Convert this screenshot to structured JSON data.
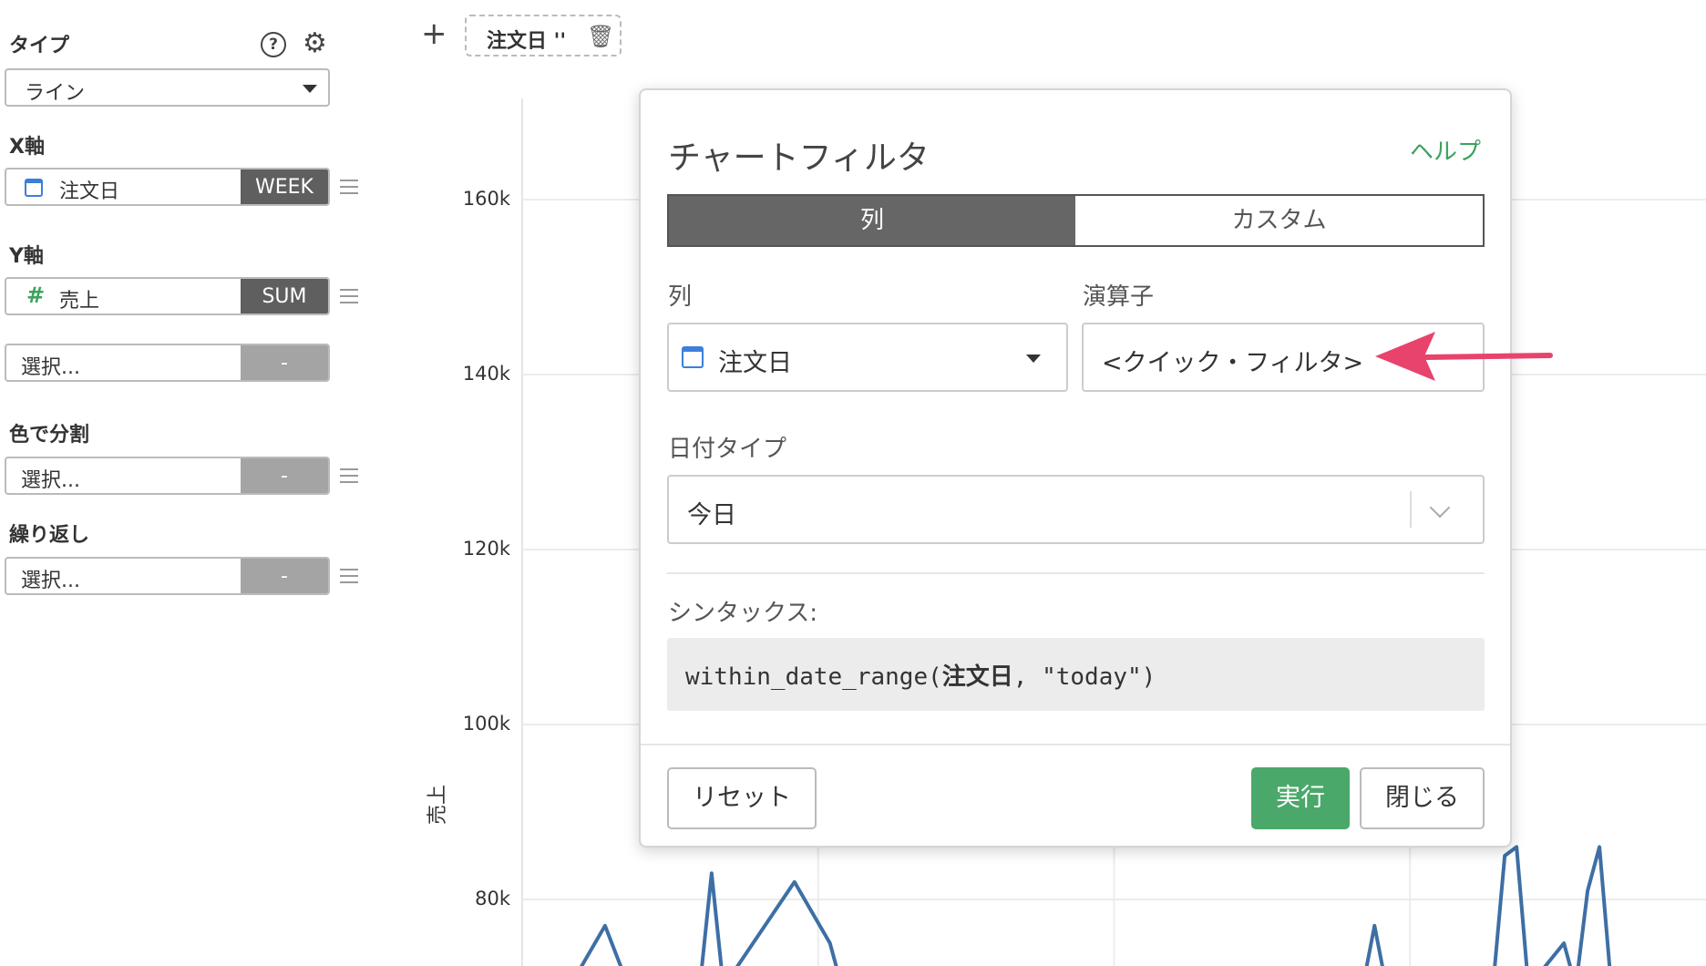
{
  "sidebar": {
    "type_label": "タイプ",
    "type_value": "ライン",
    "x_axis_label": "X軸",
    "x_field": {
      "name": "注文日",
      "agg": "WEEK"
    },
    "y_axis_label": "Y軸",
    "y_field": {
      "name": "売上",
      "agg": "SUM"
    },
    "y_field2": {
      "name": "選択...",
      "agg": "-"
    },
    "color_label": "色で分割",
    "color_field": {
      "name": "選択...",
      "agg": "-"
    },
    "repeat_label": "繰り返し",
    "repeat_field": {
      "name": "選択...",
      "agg": "-"
    }
  },
  "filter_bar": {
    "plus": "+",
    "chip_label": "注文日 ''"
  },
  "chart": {
    "ylabel": "売上",
    "ticks": [
      "160k",
      "140k",
      "120k",
      "100k",
      "80k"
    ],
    "line_color": "#3d6fa5"
  },
  "chart_data": {
    "type": "line",
    "xlabel": "",
    "ylabel": "売上",
    "y_ticks": [
      80000,
      100000,
      120000,
      140000,
      160000
    ],
    "ylim": [
      70000,
      170000
    ],
    "grid": true,
    "series": [
      {
        "values": [
          [
            0.04,
            70000
          ],
          [
            0.07,
            77000
          ],
          [
            0.09,
            70000
          ],
          [
            0.15,
            70000
          ],
          [
            0.16,
            83000
          ],
          [
            0.17,
            70000
          ],
          [
            0.23,
            82000
          ],
          [
            0.26,
            75000
          ],
          [
            0.27,
            70000
          ],
          [
            0.71,
            70000
          ],
          [
            0.72,
            77000
          ],
          [
            0.73,
            70000
          ],
          [
            0.82,
            70000
          ],
          [
            0.83,
            85000
          ],
          [
            0.84,
            86000
          ],
          [
            0.85,
            70000
          ],
          [
            0.88,
            75000
          ],
          [
            0.89,
            70000
          ],
          [
            0.9,
            81000
          ],
          [
            0.91,
            86000
          ],
          [
            0.92,
            70000
          ]
        ]
      }
    ]
  },
  "modal": {
    "title": "チャートフィルタ",
    "help": "ヘルプ",
    "tab_active": "列",
    "tab_inactive": "カスタム",
    "column_label": "列",
    "column_value": "注文日",
    "operator_label": "演算子",
    "operator_value": "<クイック・フィルタ>",
    "date_type_label": "日付タイプ",
    "date_type_value": "今日",
    "syntax_label": "シンタックス:",
    "syntax_prefix": "within_date_range(",
    "syntax_column": "注文日",
    "syntax_suffix": ", \"today\")",
    "reset": "リセット",
    "run": "実行",
    "close": "閉じる"
  },
  "colors": {
    "accent_green": "#4aa86a",
    "arrow_pink": "#e8436c",
    "calendar_blue": "#3b7fd9"
  }
}
